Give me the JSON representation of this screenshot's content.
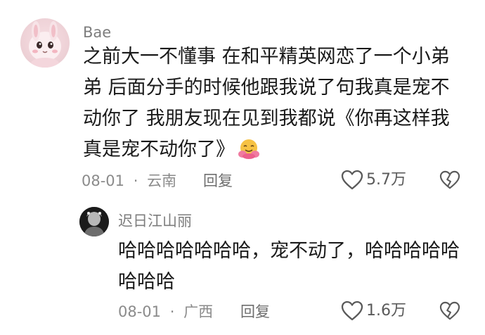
{
  "main_comment": {
    "username": "Bae",
    "lines": [
      "之前大一不懂事 在和平精英网恋了一个小弟",
      "弟 后面分手的时候他跟我说了句我真是宠不",
      "动你了 我朋友现在见到我都说《你再这样我",
      "真是宠不动你了》"
    ],
    "emoji_icon": "hugging-face-emoji",
    "date": "08-01",
    "location": "云南",
    "separator": "·",
    "reply_label": "回复",
    "like_count": "5.7万",
    "like_icon": "heart-outline-icon",
    "dislike_icon": "broken-heart-icon"
  },
  "reply_comment": {
    "username": "迟日江山丽",
    "lines": [
      "哈哈哈哈哈哈哈，宠不动了，哈哈哈哈哈",
      "哈哈哈"
    ],
    "date": "08-01",
    "location": "广西",
    "separator": "·",
    "reply_label": "回复",
    "like_count": "1.6万",
    "like_icon": "heart-outline-icon",
    "dislike_icon": "broken-heart-icon"
  },
  "colors": {
    "username": "#7d7d7d",
    "text": "#1a1a1a",
    "meta": "#8b8b8b",
    "icon": "#5a5a5a"
  }
}
